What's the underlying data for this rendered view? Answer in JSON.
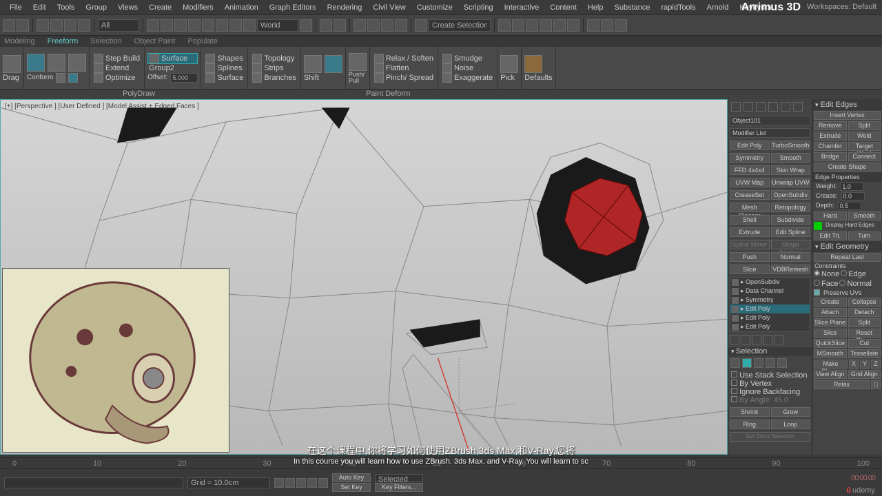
{
  "menu": [
    "File",
    "Edit",
    "Tools",
    "Group",
    "Views",
    "Create",
    "Modifiers",
    "Animation",
    "Graph Editors",
    "Rendering",
    "Civil View",
    "Customize",
    "Scripting",
    "Interactive",
    "Content",
    "Help",
    "Substance",
    "rapidTools",
    "Arnold",
    "Keyhydra"
  ],
  "brand": "Arrimus 3D",
  "workspace": {
    "label": "Workspaces:",
    "value": "Default"
  },
  "toolbar_sel": "All",
  "coord_sys": "World",
  "sel_set": "Create Selection Se",
  "ribbon_tabs": [
    "Modeling",
    "Freeform",
    "Selection",
    "Object Paint",
    "Populate"
  ],
  "ribbon": {
    "drag": "Drag",
    "conform": "Conform",
    "step_build": "Step Build",
    "extend": "Extend",
    "optimize": "Optimize",
    "surface": "Surface",
    "group2": "Group2",
    "offset_lbl": "Offset:",
    "offset_val": "5.000",
    "shapes": "Shapes",
    "splines": "Splines",
    "surface2": "Surface",
    "topology": "Topology",
    "strips": "Strips",
    "branches": "Branches",
    "shift": "Shift",
    "push_pull": "Push/\nPull",
    "relax": "Relax / Soften",
    "flatten": "Flatten",
    "pinch": "Pinch/ Spread",
    "smudge": "Smudge",
    "noise": "Noise",
    "exaggerate": "Exaggerate",
    "pick": "Pick",
    "defaults": "Defaults",
    "footer1": "PolyDraw",
    "footer2": "Paint Deform"
  },
  "vp_label": "[+] [Perspective ] [User Defined ] [Model Assist + Edged Faces ]",
  "cmd_panel": {
    "obj_name": "Object101",
    "mod_list_lbl": "Modifier List",
    "buttons": [
      [
        "Edit Poly",
        "TurboSmooth"
      ],
      [
        "Symmetry",
        "Smooth"
      ],
      [
        "FFD 4x4x4",
        "Skin Wrap"
      ],
      [
        "UVW Map",
        "Unwrap UVW"
      ],
      [
        "CreaseSet",
        "OpenSubdiv"
      ],
      [
        "Mesh Cleaner",
        "Retopology"
      ],
      [
        "Shell",
        "Subdivide"
      ],
      [
        "Extrude",
        "Edit Spline"
      ],
      [
        "Spline Mirror",
        "Shape Boolean"
      ],
      [
        "Push",
        "Normal"
      ],
      [
        "Slice",
        "VDBRemesh"
      ]
    ],
    "stack": [
      "OpenSubdiv",
      "Data Channel",
      "Symmetry",
      "Edit Poly",
      "Edit Poly",
      "Edit Poly"
    ],
    "selection": "Selection",
    "stack_sel": "Use Stack Selection",
    "by_vertex": "By Vertex",
    "ignore_bf": "Ignore Backfacing",
    "by_angle": "By Angle: 45.0",
    "shrink": "Shrink",
    "grow": "Grow",
    "ring": "Ring",
    "loop": "Loop",
    "get_stack": "Get Stack Selection"
  },
  "edit_edges": {
    "title": "Edit Edges",
    "insert_v": "Insert Vertex",
    "rows": [
      [
        "Remove",
        "Split"
      ],
      [
        "Extrude",
        "Weld"
      ],
      [
        "Chamfer",
        "Target Weld"
      ],
      [
        "Bridge",
        "Connect"
      ]
    ],
    "create_shape": "Create Shape",
    "edge_props": "Edge Properties",
    "weight": "Weight:",
    "weight_v": "1.0",
    "crease": "Crease:",
    "crease_v": "0.0",
    "depth": "Depth:",
    "depth_v": "0.5",
    "hard": "Hard",
    "smooth": "Smooth",
    "display_hard": "Display Hard Edges",
    "edit_tri": "Edit Tri.",
    "turn": "Turn",
    "edit_geom": "Edit Geometry",
    "repeat": "Repeat Last",
    "constraints": "Constraints",
    "none": "None",
    "edge": "Edge",
    "face": "Face",
    "normal": "Normal",
    "preserve": "Preserve UVs",
    "create": "Create",
    "collapse": "Collapse",
    "attach": "Attach",
    "detach": "Detach",
    "slice_plane": "Slice Plane",
    "split": "Split",
    "slice": "Slice",
    "reset_plane": "Reset Plane",
    "quickslice": "QuickSlice",
    "cut": "Cut",
    "msmooth": "MSmooth",
    "tessellate": "Tessellate",
    "make_planar": "Make Planar",
    "x": "X",
    "y": "Y",
    "z": "Z",
    "view_align": "View Align",
    "grid_align": "Grid Align",
    "relax": "Relax"
  },
  "timeline_ticks": [
    "0",
    "10",
    "20",
    "30",
    "40",
    "50",
    "60",
    "70",
    "80",
    "90",
    "100"
  ],
  "status": {
    "grid": "Grid = 10.0cm",
    "auto_key": "Auto Key",
    "set_key": "Set Key",
    "selected": "Selected",
    "key_filters": "Key Filters..."
  },
  "timecode": "00:00.00",
  "subtitle_cn": "在这个课程中,你将学习如何使用ZBrush,3ds Max,和V-Ray,您将",
  "subtitle_en": "In this course you will learn how to use ZBrush. 3ds Max. and V-Ray. You will learn to sc",
  "udemy": "udemy"
}
